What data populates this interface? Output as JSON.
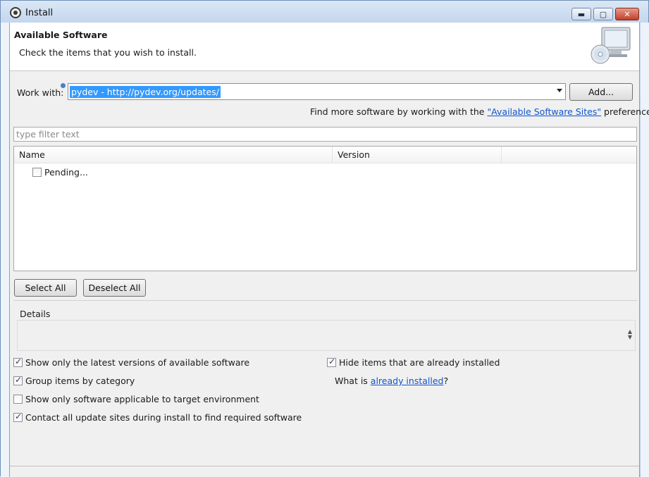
{
  "window": {
    "title": "Install",
    "minimize_glyph": "▬",
    "maximize_glyph": "▢",
    "close_glyph": "✕"
  },
  "header": {
    "title": "Available Software",
    "description": "Check the items that you wish to install.",
    "image_icon": "cd-monitor-icon"
  },
  "work_with": {
    "label": "Work with:",
    "value": "pydev - http://pydev.org/updates/",
    "add_label": "Add..."
  },
  "find_more": {
    "prefix": "Find more software by working with the ",
    "link": "\"Available Software Sites\"",
    "suffix": " preferences."
  },
  "filter": {
    "placeholder": "type filter text"
  },
  "tree": {
    "columns": [
      "Name",
      "Version"
    ],
    "rows": [
      {
        "label": "Pending...",
        "checked": false
      }
    ]
  },
  "buttons": {
    "select_all": "Select All",
    "deselect_all": "Deselect All"
  },
  "details": {
    "label": "Details"
  },
  "options": {
    "show_latest": {
      "label": "Show only the latest versions of available software",
      "checked": true
    },
    "group_by_category": {
      "label": "Group items by category",
      "checked": true
    },
    "show_applicable": {
      "label": "Show only software applicable to target environment",
      "checked": false
    },
    "contact_update_sites": {
      "label": "Contact all update sites during install to find required software",
      "checked": true
    },
    "hide_installed": {
      "label": "Hide items that are already installed",
      "checked": true
    }
  },
  "what_is": {
    "prefix": "What is ",
    "link": "already installed",
    "suffix": "?"
  },
  "colors": {
    "selection": "#3399ff",
    "link": "#1155cc",
    "client_bg": "#f0f0f0"
  }
}
